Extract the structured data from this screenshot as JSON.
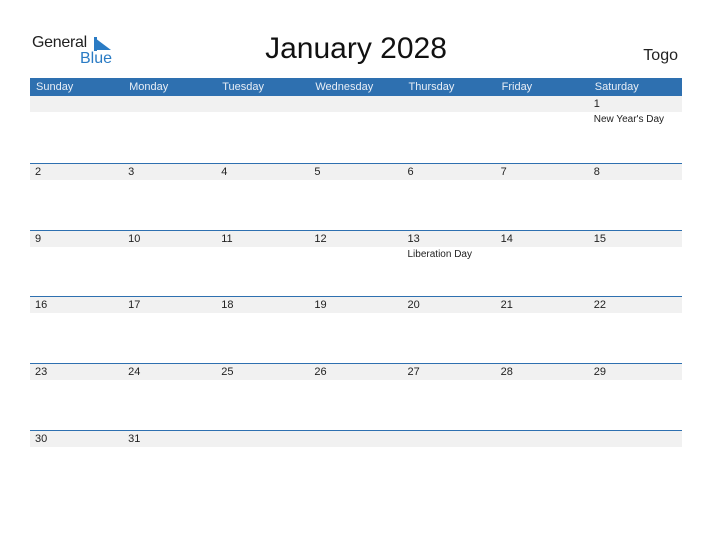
{
  "logo": {
    "line1": "General",
    "line2": "Blue"
  },
  "title": "January 2028",
  "country": "Togo",
  "colors": {
    "header_bg": "#2e70b0",
    "brand_blue": "#2a7bc4",
    "date_strip": "#f1f1f1"
  },
  "weekdays": [
    "Sunday",
    "Monday",
    "Tuesday",
    "Wednesday",
    "Thursday",
    "Friday",
    "Saturday"
  ],
  "weeks": [
    [
      {
        "day": ""
      },
      {
        "day": ""
      },
      {
        "day": ""
      },
      {
        "day": ""
      },
      {
        "day": ""
      },
      {
        "day": ""
      },
      {
        "day": "1",
        "holiday": "New Year's Day"
      }
    ],
    [
      {
        "day": "2"
      },
      {
        "day": "3"
      },
      {
        "day": "4"
      },
      {
        "day": "5"
      },
      {
        "day": "6"
      },
      {
        "day": "7"
      },
      {
        "day": "8"
      }
    ],
    [
      {
        "day": "9"
      },
      {
        "day": "10"
      },
      {
        "day": "11"
      },
      {
        "day": "12"
      },
      {
        "day": "13",
        "holiday": "Liberation Day"
      },
      {
        "day": "14"
      },
      {
        "day": "15"
      }
    ],
    [
      {
        "day": "16"
      },
      {
        "day": "17"
      },
      {
        "day": "18"
      },
      {
        "day": "19"
      },
      {
        "day": "20"
      },
      {
        "day": "21"
      },
      {
        "day": "22"
      }
    ],
    [
      {
        "day": "23"
      },
      {
        "day": "24"
      },
      {
        "day": "25"
      },
      {
        "day": "26"
      },
      {
        "day": "27"
      },
      {
        "day": "28"
      },
      {
        "day": "29"
      }
    ],
    [
      {
        "day": "30"
      },
      {
        "day": "31"
      },
      {
        "day": ""
      },
      {
        "day": ""
      },
      {
        "day": ""
      },
      {
        "day": ""
      },
      {
        "day": ""
      }
    ]
  ]
}
